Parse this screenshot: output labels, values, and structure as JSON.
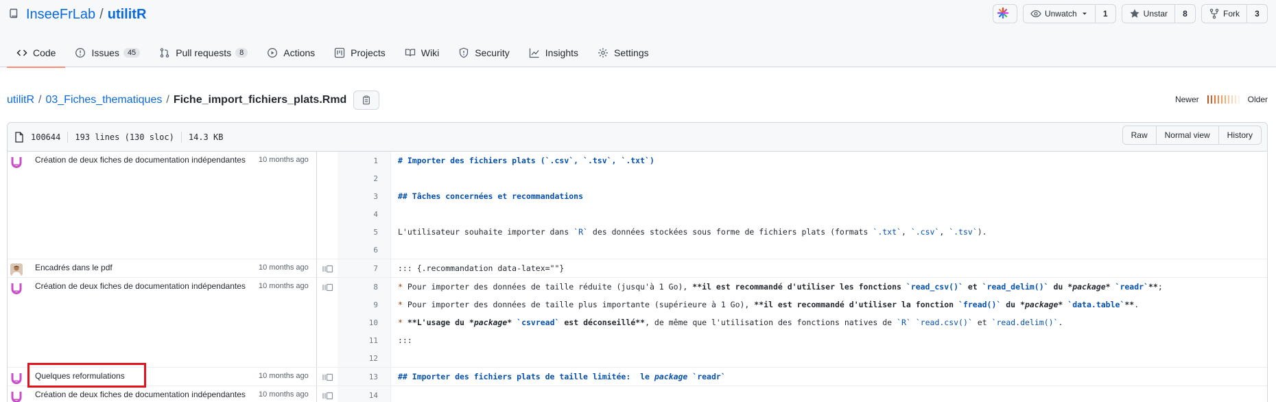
{
  "repo": {
    "owner": "InseeFrLab",
    "separator": "/",
    "name": "utilitR"
  },
  "header_actions": {
    "unwatch": {
      "label": "Unwatch",
      "count": "1"
    },
    "unstar": {
      "label": "Unstar",
      "count": "8"
    },
    "fork": {
      "label": "Fork",
      "count": "3"
    }
  },
  "tabs": [
    {
      "label": "Code",
      "icon": "code-icon",
      "active": true
    },
    {
      "label": "Issues",
      "icon": "issue-icon",
      "counter": "45"
    },
    {
      "label": "Pull requests",
      "icon": "pull-request-icon",
      "counter": "8"
    },
    {
      "label": "Actions",
      "icon": "play-icon"
    },
    {
      "label": "Projects",
      "icon": "project-icon"
    },
    {
      "label": "Wiki",
      "icon": "book-icon"
    },
    {
      "label": "Security",
      "icon": "shield-icon"
    },
    {
      "label": "Insights",
      "icon": "graph-icon"
    },
    {
      "label": "Settings",
      "icon": "gear-icon"
    }
  ],
  "breadcrumb": {
    "root": "utilitR",
    "folder": "03_Fiches_thematiques",
    "sep": "/",
    "file": "Fiche_import_fichiers_plats.Rmd"
  },
  "legend": {
    "newer": "Newer",
    "older": "Older"
  },
  "file_info": {
    "mode": "100644",
    "lines": "193 lines (130 sloc)",
    "size": "14.3 KB",
    "buttons": {
      "raw": "Raw",
      "normal_view": "Normal view",
      "history": "History"
    }
  },
  "hunks": [
    {
      "message": "Création de deux fiches de documentation indépendantes",
      "age": "10 months ago",
      "avatar": "purple-logo",
      "lines": [
        {
          "n": "1",
          "text": "# Importer des fichiers plats (`.csv`, `.tsv`, `.txt`)"
        },
        {
          "n": "2",
          "text": ""
        },
        {
          "n": "3",
          "text": "## Tâches concernées et recommandations"
        },
        {
          "n": "4",
          "text": ""
        },
        {
          "n": "5",
          "text": "L'utilisateur souhaite importer dans `R` des données stockées sous forme de fichiers plats (formats `.txt`, `.csv`, `.tsv`)."
        },
        {
          "n": "6",
          "text": ""
        }
      ]
    },
    {
      "message": "Encadrés dans le pdf",
      "age": "10 months ago",
      "avatar": "person-photo",
      "lines": [
        {
          "n": "7",
          "text": "::: {.recommandation data-latex=\"\"}"
        }
      ]
    },
    {
      "message": "Création de deux fiches de documentation indépendantes",
      "age": "10 months ago",
      "avatar": "purple-logo",
      "lines": [
        {
          "n": "8",
          "text": "* Pour importer des données de taille réduite (jusqu'à 1 Go), **il est recommandé d'utiliser les fonctions `read_csv()` et `read_delim()` du *package* `readr`**;"
        },
        {
          "n": "9",
          "text": "* Pour importer des données de taille plus importante (supérieure à 1 Go), **il est recommandé d'utiliser la fonction `fread()` du *package* `data.table`**."
        },
        {
          "n": "10",
          "text": "* **L'usage du *package* `csvread` est déconseillé**, de même que l'utilisation des fonctions natives de `R` `read.csv()` et `read.delim()`."
        },
        {
          "n": "11",
          "text": ":::"
        },
        {
          "n": "12",
          "text": ""
        }
      ]
    },
    {
      "message": "Quelques reformulations",
      "age": "10 months ago",
      "avatar": "purple-logo",
      "lines": [
        {
          "n": "13",
          "text": "## Importer des fichiers plats de taille limitée:  le *package* `readr`"
        }
      ]
    },
    {
      "message": "Création de deux fiches de documentation indépendantes",
      "age": "10 months ago",
      "avatar": "purple-logo",
      "lines": [
        {
          "n": "14",
          "text": ""
        }
      ]
    }
  ],
  "colors": {
    "accent": "#0969da",
    "tab_underline": "#fd8c73",
    "highlight": "#e4111b",
    "commit_logo": "#c94fc8"
  }
}
